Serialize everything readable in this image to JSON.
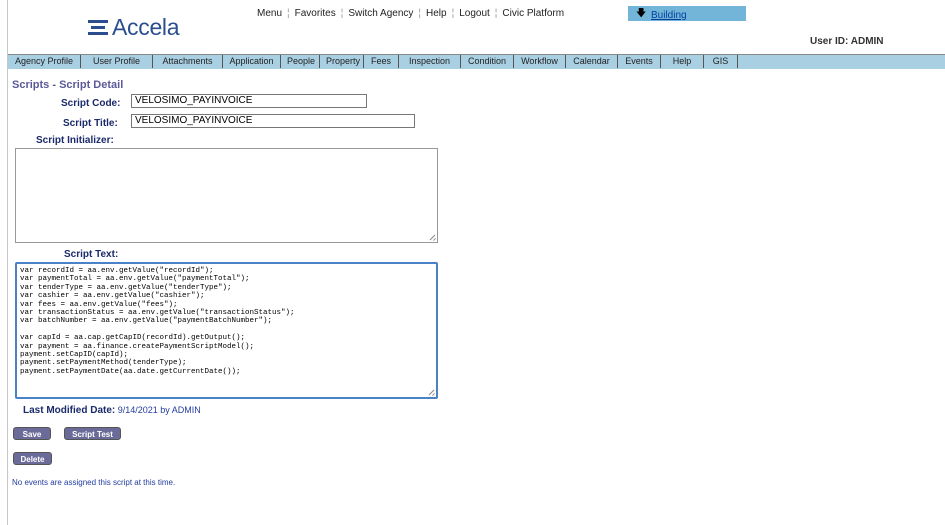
{
  "header": {
    "logo_text": "Accela",
    "menu": [
      "Menu",
      "Favorites",
      "Switch Agency",
      "Help",
      "Logout",
      "Civic Platform"
    ],
    "module_arrow": "🡇",
    "module_link": "Building",
    "user_id": "User ID: ADMIN"
  },
  "tabs": [
    "Agency Profile",
    "User Profile",
    "Attachments",
    "Application",
    "People",
    "Property",
    "Fees",
    "Inspection",
    "Condition",
    "Workflow",
    "Calendar",
    "Events",
    "Help",
    "GIS"
  ],
  "page": {
    "title": "Scripts - Script Detail",
    "script_code_label": "Script Code:",
    "script_code_value": "VELOSIMO_PAYINVOICE",
    "script_title_label": "Script Title:",
    "script_title_value": "VELOSIMO_PAYINVOICE",
    "script_initializer_label": "Script Initializer:",
    "script_initializer_value": "",
    "script_text_label": "Script Text:",
    "script_text_value": "var recordId = aa.env.getValue(\"recordId\");\nvar paymentTotal = aa.env.getValue(\"paymentTotal\");\nvar tenderType = aa.env.getValue(\"tenderType\");\nvar cashier = aa.env.getValue(\"cashier\");\nvar fees = aa.env.getValue(\"fees\");\nvar transactionStatus = aa.env.getValue(\"transactionStatus\");\nvar batchNumber = aa.env.getValue(\"paymentBatchNumber\");\n\nvar capId = aa.cap.getCapID(recordId).getOutput();\nvar payment = aa.finance.createPaymentScriptModel();\npayment.setCapID(capId);\npayment.setPaymentMethod(tenderType);\npayment.setPaymentDate(aa.date.getCurrentDate());",
    "last_modified_label": "Last Modified Date:",
    "last_modified_value": "9/14/2021 by ADMIN",
    "save_button": "Save",
    "script_test_button": "Script Test",
    "delete_button": "Delete",
    "events_note": "No events are assigned this script at this time."
  },
  "colors": {
    "brand": "#2b4f8e",
    "tab_bar": "#a9cfe3",
    "module_box": "#73b5d8",
    "label": "#1a2a6a",
    "title": "#5a5a9a",
    "button": "#6b6b9a",
    "note": "#223ca0"
  }
}
